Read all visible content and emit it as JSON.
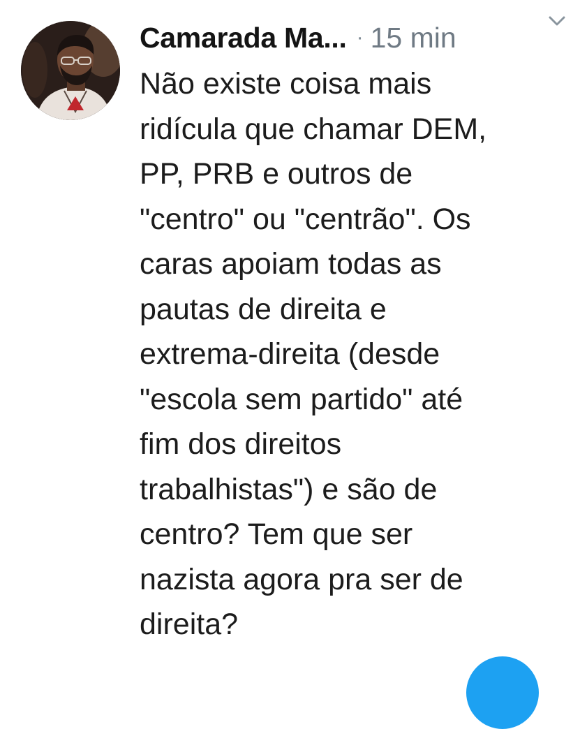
{
  "tweet": {
    "author_name": "Camarada Ma...",
    "separator": "·",
    "timestamp": "15 min",
    "text_lines": [
      "Não existe coisa mais",
      "ridícula que chamar DEM,",
      "PP, PRB e outros de",
      "\"centro\" ou \"centrão\". Os",
      "caras apoiam todas as",
      "pautas de direita e",
      "extrema-direita (desde",
      "\"escola sem partido\" até",
      "fim dos direitos",
      "trabalhistas\") e são de",
      "centro? Tem que ser",
      "nazista agora pra ser de",
      "direita?"
    ]
  },
  "icons": {
    "menu": "chevron-down-icon",
    "compose": "compose-fab"
  },
  "colors": {
    "text": "#1c1c1c",
    "muted": "#6f7a84",
    "accent": "#1da1f2"
  }
}
